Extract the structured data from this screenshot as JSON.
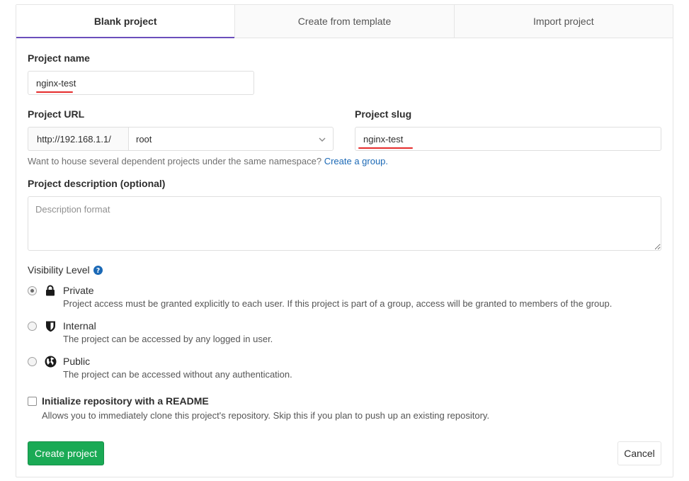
{
  "tabs": [
    {
      "label": "Blank project",
      "active": true
    },
    {
      "label": "Create from template",
      "active": false
    },
    {
      "label": "Import project",
      "active": false
    }
  ],
  "project_name": {
    "label": "Project name",
    "value": "nginx-test"
  },
  "project_url": {
    "label": "Project URL",
    "prefix": "http://192.168.1.1/",
    "namespace": "root"
  },
  "project_slug": {
    "label": "Project slug",
    "value": "nginx-test"
  },
  "namespace_help": {
    "text": "Want to house several dependent projects under the same namespace?",
    "link": "Create a group."
  },
  "description": {
    "label": "Project description (optional)",
    "placeholder": "Description format"
  },
  "visibility": {
    "label": "Visibility Level",
    "help_icon": "question-circle-icon",
    "options": [
      {
        "title": "Private",
        "desc": "Project access must be granted explicitly to each user. If this project is part of a group, access will be granted to members of the group.",
        "icon": "lock-icon",
        "checked": true
      },
      {
        "title": "Internal",
        "desc": "The project can be accessed by any logged in user.",
        "icon": "shield-icon",
        "checked": false
      },
      {
        "title": "Public",
        "desc": "The project can be accessed without any authentication.",
        "icon": "globe-icon",
        "checked": false
      }
    ]
  },
  "readme": {
    "label": "Initialize repository with a README",
    "desc": "Allows you to immediately clone this project's repository. Skip this if you plan to push up an existing repository.",
    "checked": false
  },
  "actions": {
    "create": "Create project",
    "cancel": "Cancel"
  },
  "colors": {
    "accent_tab": "#6b4fbb",
    "create_button": "#1aaa55",
    "link": "#1b69b6",
    "annotation_underline": "#e52b2b"
  }
}
